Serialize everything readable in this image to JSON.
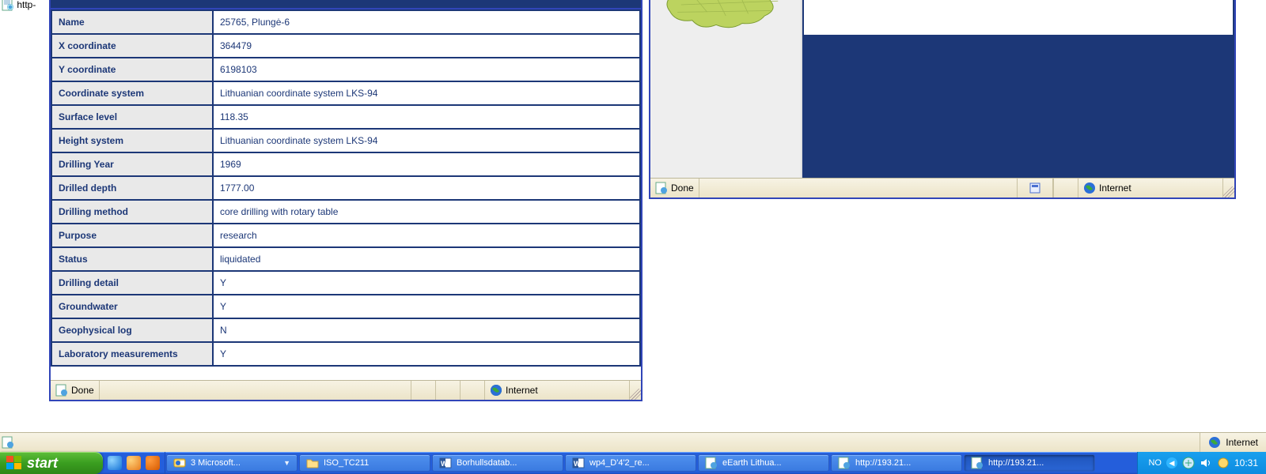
{
  "outer": {
    "address_hint": "http-"
  },
  "details": {
    "rows": [
      {
        "k": "Name",
        "v": "25765, Plungė-6"
      },
      {
        "k": "X coordinate",
        "v": "364479"
      },
      {
        "k": "Y coordinate",
        "v": "6198103"
      },
      {
        "k": "Coordinate system",
        "v": "Lithuanian coordinate system LKS-94"
      },
      {
        "k": "Surface level",
        "v": "118.35"
      },
      {
        "k": "Height system",
        "v": "Lithuanian coordinate system LKS-94"
      },
      {
        "k": "Drilling Year",
        "v": "1969"
      },
      {
        "k": "Drilled depth",
        "v": "1777.00"
      },
      {
        "k": "Drilling method",
        "v": "core drilling with rotary table"
      },
      {
        "k": "Purpose",
        "v": "research"
      },
      {
        "k": "Status",
        "v": "liquidated"
      },
      {
        "k": "Drilling detail",
        "v": "Y"
      },
      {
        "k": "Groundwater",
        "v": "Y"
      },
      {
        "k": "Geophysical log",
        "v": "N"
      },
      {
        "k": "Laboratory measurements",
        "v": "Y"
      }
    ]
  },
  "left_status": {
    "text": "Done",
    "zone": "Internet"
  },
  "right_status": {
    "text": "Done",
    "zone": "Internet"
  },
  "outer_status": {
    "zone": "Internet"
  },
  "taskbar": {
    "start": "start",
    "items": [
      {
        "label": "3 Microsoft...",
        "icon": "outlook",
        "grouped": true
      },
      {
        "label": "ISO_TC211",
        "icon": "folder"
      },
      {
        "label": "Borhullsdatab...",
        "icon": "word"
      },
      {
        "label": "wp4_D'4'2_re...",
        "icon": "word"
      },
      {
        "label": "eEarth Lithua...",
        "icon": "iepage"
      },
      {
        "label": "http://193.21...",
        "icon": "iepage"
      },
      {
        "label": "http://193.21...",
        "icon": "iepage",
        "active": true
      }
    ],
    "tray": {
      "lang": "NO",
      "clock": "10:31"
    }
  }
}
